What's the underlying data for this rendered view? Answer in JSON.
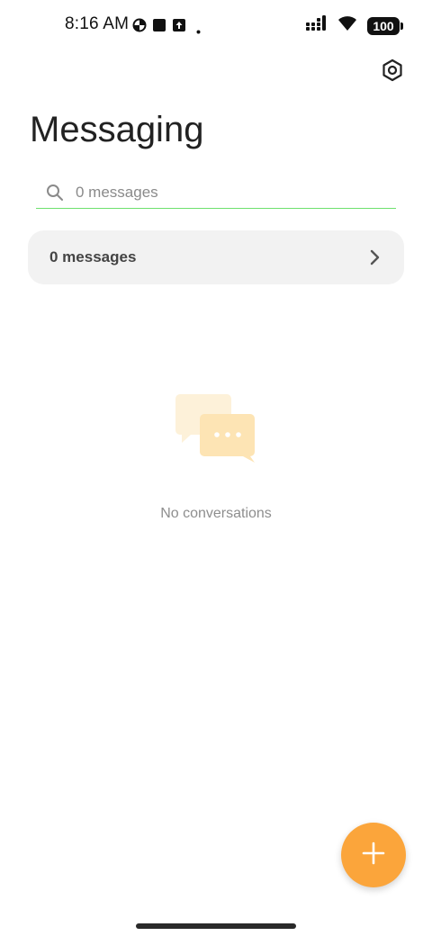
{
  "status_bar": {
    "time": "8:16 AM",
    "battery": "100",
    "icons": [
      "data-saver-icon",
      "square-notification-icon",
      "upload-notification-icon",
      "dot-icon",
      "signal-icon",
      "wifi-icon",
      "battery-icon"
    ]
  },
  "header": {
    "title": "Messaging",
    "settings_icon": "settings-hex-icon"
  },
  "search": {
    "placeholder": "0 messages",
    "value": ""
  },
  "messages_card": {
    "label": "0 messages"
  },
  "empty_state": {
    "text": "No conversations",
    "icon": "chat-bubbles-icon"
  },
  "fab": {
    "icon": "plus-icon"
  },
  "colors": {
    "accent": "#fba53b",
    "search_underline": "#6ee06e",
    "card_bg": "#f2f2f2"
  }
}
